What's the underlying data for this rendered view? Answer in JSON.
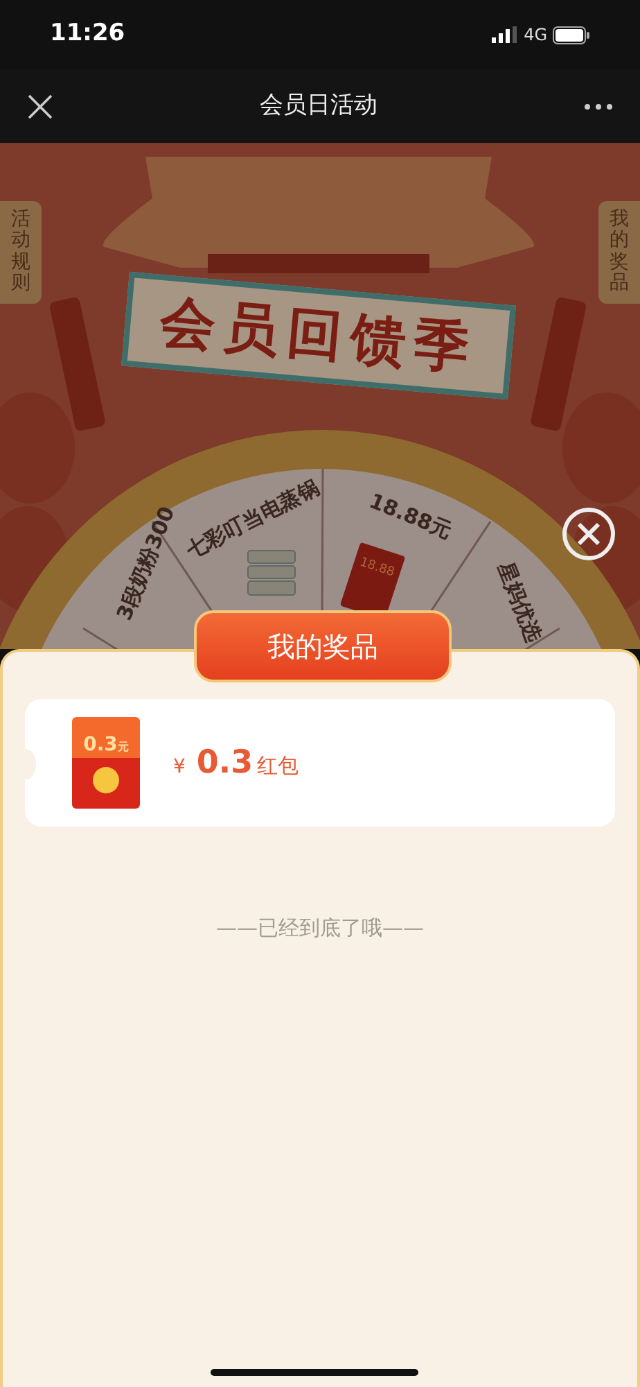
{
  "status_bar": {
    "time": "11:26",
    "network": "4G"
  },
  "nav_bar": {
    "title": "会员日活动"
  },
  "banner": {
    "title": "会员回馈季",
    "side_tabs": [
      "活动规则",
      "我的奖品"
    ]
  },
  "wheel": {
    "segments": [
      {
        "label": "3段奶粉300",
        "kind": "milk"
      },
      {
        "label": "七彩叮当电蒸锅",
        "kind": "steamer"
      },
      {
        "label": "18.88元",
        "kind": "red_packet",
        "amount": "18.88"
      },
      {
        "label": "星妈优选",
        "kind": "plain"
      }
    ]
  },
  "prizes_panel": {
    "title": "我的奖品",
    "items": [
      {
        "thumb_amount": "0.3",
        "thumb_unit": "元",
        "currency": "¥",
        "amount": "0.3",
        "type": "红包"
      }
    ],
    "end_text": "——已经到底了哦——"
  }
}
